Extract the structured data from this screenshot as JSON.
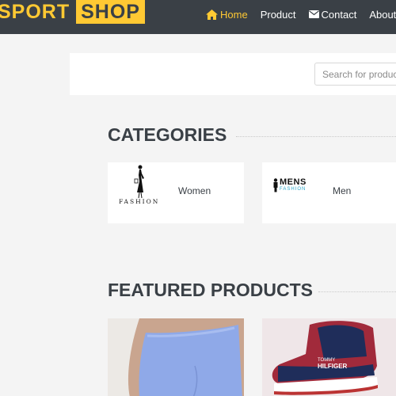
{
  "header": {
    "logo_part1": "SPORT",
    "logo_part2": "SHOP",
    "nav": [
      {
        "label": "Home",
        "icon": "home-icon",
        "active": true
      },
      {
        "label": "Product",
        "icon": null,
        "active": false
      },
      {
        "label": "Contact",
        "icon": "envelope-icon",
        "active": false
      },
      {
        "label": "About U",
        "icon": null,
        "active": false
      }
    ]
  },
  "search": {
    "placeholder": "Search for produc"
  },
  "categories": {
    "title": "CATEGORIES",
    "items": [
      {
        "label": "Women",
        "logo_text": "FASHION"
      },
      {
        "label": "Men",
        "logo_text_top": "MENS",
        "logo_text_bottom": "FASHION"
      }
    ]
  },
  "featured": {
    "title": "FEATURED PRODUCTS",
    "items": [
      {
        "name": "blue-leggings"
      },
      {
        "name": "hilfiger-sneaker",
        "brand_text_top": "TOMMY",
        "brand_text_bottom": "HILFIGER"
      }
    ]
  },
  "colors": {
    "header_bg": "#3a4046",
    "accent": "#ffc933",
    "page_bg": "#f4f4f4"
  }
}
